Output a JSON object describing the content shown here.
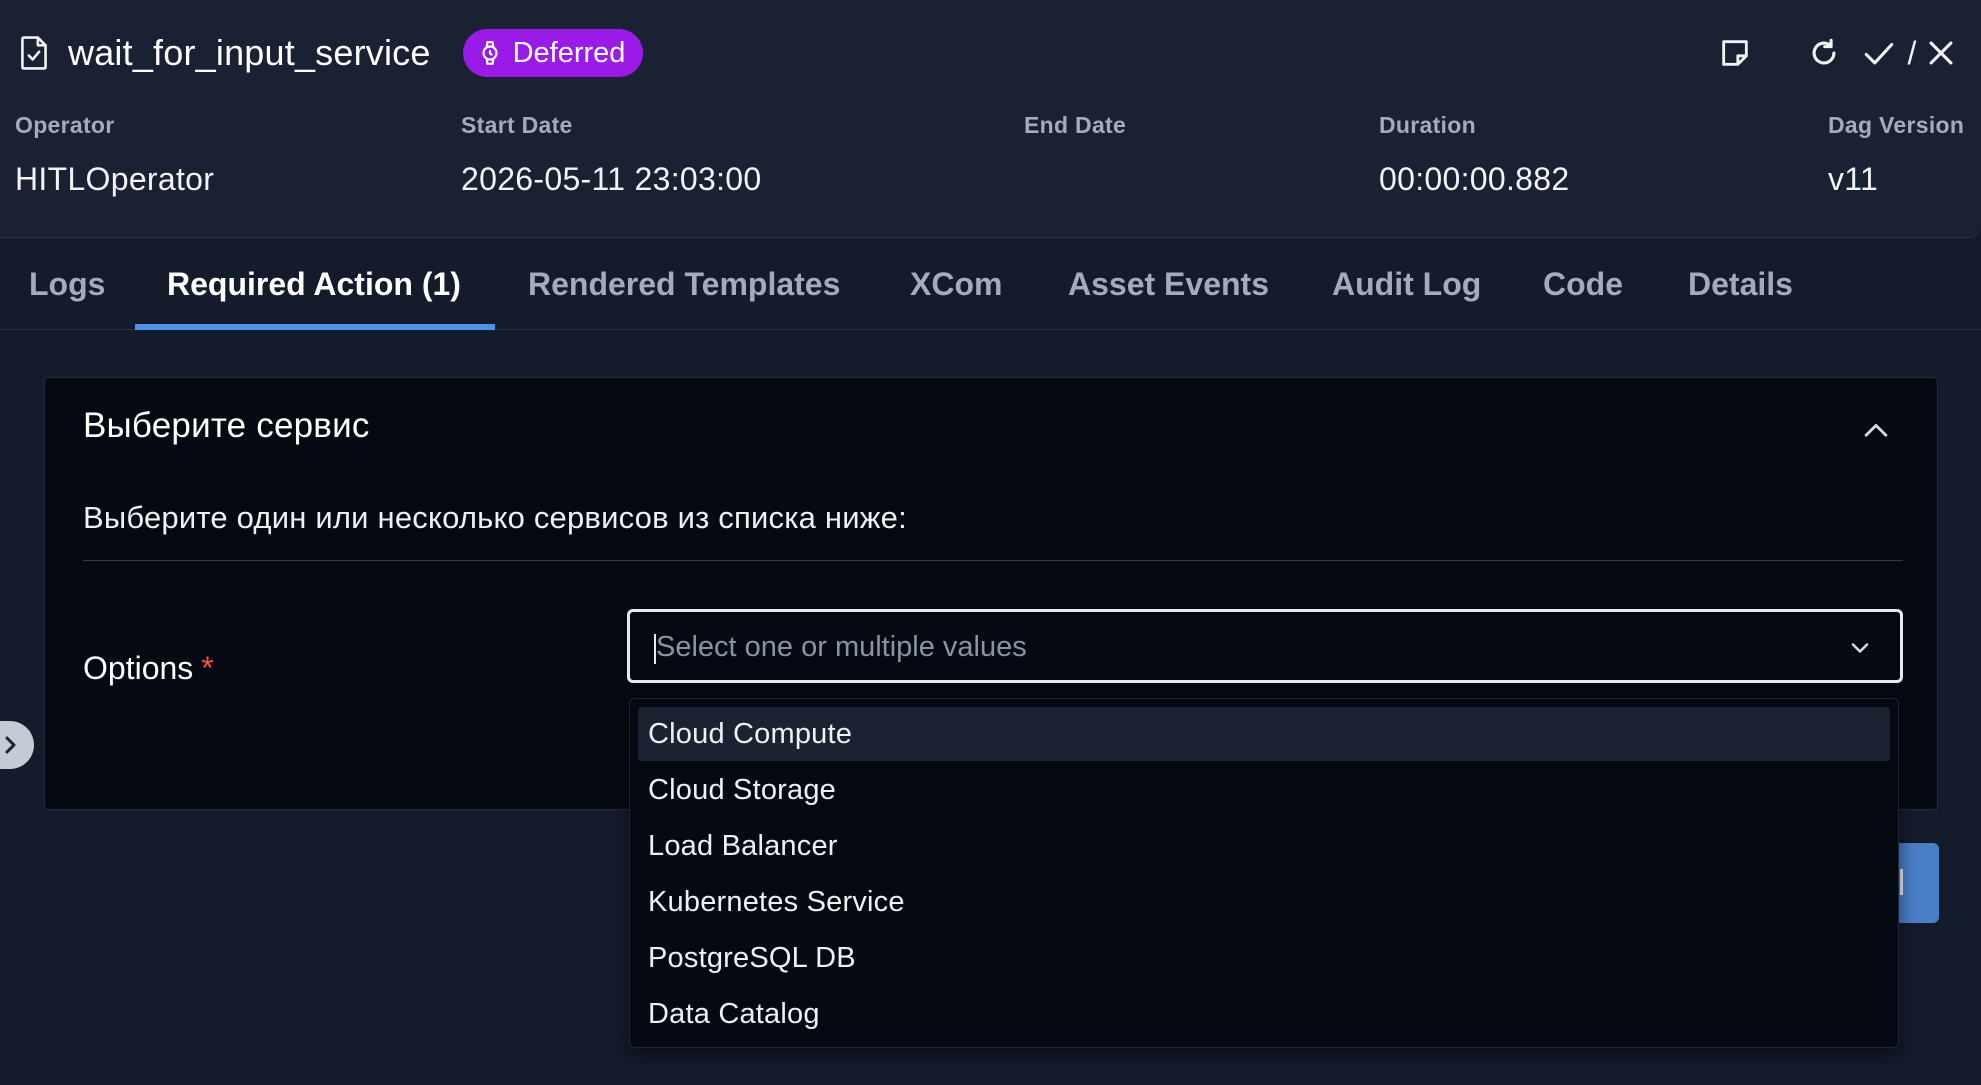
{
  "task": {
    "name": "wait_for_input_service",
    "state": "Deferred",
    "state_color": "#9a1be8"
  },
  "header_actions": {
    "note_icon": "note-icon",
    "refresh_icon": "refresh-icon",
    "check_icon": "check-icon",
    "separator": "/",
    "close_icon": "close-icon"
  },
  "meta": [
    {
      "label": "Operator",
      "value": "HITLOperator"
    },
    {
      "label": "Start Date",
      "value": "2026-05-11 23:03:00"
    },
    {
      "label": "End Date",
      "value": ""
    },
    {
      "label": "Duration",
      "value": "00:00:00.882"
    },
    {
      "label": "Dag Version",
      "value": "v11"
    }
  ],
  "tabs": [
    {
      "label": "Logs",
      "active": false
    },
    {
      "label": "Required Action (1)",
      "active": true
    },
    {
      "label": "Rendered Templates",
      "active": false
    },
    {
      "label": "XCom",
      "active": false
    },
    {
      "label": "Asset Events",
      "active": false
    },
    {
      "label": "Audit Log",
      "active": false
    },
    {
      "label": "Code",
      "active": false
    },
    {
      "label": "Details",
      "active": false
    }
  ],
  "accent_color": "#4d91e8",
  "form": {
    "title": "Выберите сервис",
    "description": "Выберите один или несколько сервисов из списка ниже:",
    "options_label": "Options",
    "required_mark": "*",
    "select_placeholder": "Select one or multiple values",
    "select_value": "",
    "dropdown_options": [
      "Cloud Compute",
      "Cloud Storage",
      "Load Balancer",
      "Kubernetes Service",
      "PostgreSQL DB",
      "Data Catalog"
    ],
    "hovered_option": "Cloud Compute"
  }
}
